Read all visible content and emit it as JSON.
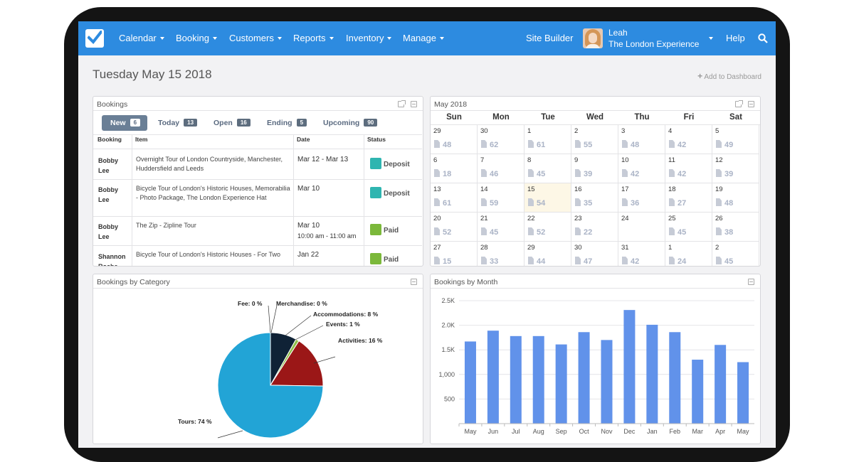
{
  "nav": {
    "menu": [
      {
        "label": "Calendar"
      },
      {
        "label": "Booking"
      },
      {
        "label": "Customers"
      },
      {
        "label": "Reports"
      },
      {
        "label": "Inventory"
      },
      {
        "label": "Manage"
      }
    ],
    "site_builder": "Site Builder",
    "user_name": "Leah",
    "user_company": "The London Experience",
    "help": "Help",
    "accent": "#2d8be0"
  },
  "page": {
    "title": "Tuesday May 15 2018",
    "add_to_dashboard": "Add to Dashboard"
  },
  "bookings": {
    "title": "Bookings",
    "tabs": [
      {
        "label": "New",
        "count": "6"
      },
      {
        "label": "Today",
        "count": "13"
      },
      {
        "label": "Open",
        "count": "16"
      },
      {
        "label": "Ending",
        "count": "5"
      },
      {
        "label": "Upcoming",
        "count": "90"
      }
    ],
    "columns": [
      "Booking",
      "Item",
      "Date",
      "Status"
    ],
    "rows": [
      {
        "name": "Bobby Lee",
        "item": "Overnight Tour of London Countryside, Manchester, Huddersfield and Leeds",
        "date": "Mar 12 - Mar 13",
        "time": "",
        "status": "Deposit",
        "color": "#2fb5b0"
      },
      {
        "name": "Bobby Lee",
        "item": "Bicycle Tour of London's Historic Houses, Memorabilia - Photo Package, The London Experience Hat",
        "date": "Mar 10",
        "time": "",
        "status": "Deposit",
        "color": "#2fb5b0"
      },
      {
        "name": "Bobby Lee",
        "item": "The Zip - Zipline Tour",
        "date": "Mar 10",
        "time": "10:00 am - 11:00 am",
        "status": "Paid",
        "color": "#7bb83a"
      },
      {
        "name": "Shannon Roche",
        "item": "Bicycle Tour of London's Historic Houses - For Two",
        "date": "Jan 22",
        "time": "",
        "status": "Paid",
        "color": "#7bb83a"
      }
    ]
  },
  "calendar": {
    "title": "May 2018",
    "days_of_week": [
      "Sun",
      "Mon",
      "Tue",
      "Wed",
      "Thu",
      "Fri",
      "Sat"
    ],
    "weeks": [
      [
        {
          "d": "29",
          "c": "48"
        },
        {
          "d": "30",
          "c": "62"
        },
        {
          "d": "1",
          "c": "61"
        },
        {
          "d": "2",
          "c": "55"
        },
        {
          "d": "3",
          "c": "48"
        },
        {
          "d": "4",
          "c": "42"
        },
        {
          "d": "5",
          "c": "49"
        }
      ],
      [
        {
          "d": "6",
          "c": "18"
        },
        {
          "d": "7",
          "c": "46"
        },
        {
          "d": "8",
          "c": "45"
        },
        {
          "d": "9",
          "c": "39"
        },
        {
          "d": "10",
          "c": "42"
        },
        {
          "d": "11",
          "c": "42"
        },
        {
          "d": "12",
          "c": "39"
        }
      ],
      [
        {
          "d": "13",
          "c": "61"
        },
        {
          "d": "14",
          "c": "59"
        },
        {
          "d": "15",
          "c": "54",
          "today": true
        },
        {
          "d": "16",
          "c": "35"
        },
        {
          "d": "17",
          "c": "36"
        },
        {
          "d": "18",
          "c": "27"
        },
        {
          "d": "19",
          "c": "48"
        }
      ],
      [
        {
          "d": "20",
          "c": "52"
        },
        {
          "d": "21",
          "c": "45"
        },
        {
          "d": "22",
          "c": "52"
        },
        {
          "d": "23",
          "c": "22"
        },
        {
          "d": "24",
          "c": ""
        },
        {
          "d": "25",
          "c": "45"
        },
        {
          "d": "26",
          "c": "38"
        }
      ],
      [
        {
          "d": "27",
          "c": "15"
        },
        {
          "d": "28",
          "c": "33"
        },
        {
          "d": "29",
          "c": "44"
        },
        {
          "d": "30",
          "c": "47"
        },
        {
          "d": "31",
          "c": "42"
        },
        {
          "d": "1",
          "c": "24"
        },
        {
          "d": "2",
          "c": "45"
        }
      ]
    ]
  },
  "category_chart": {
    "panel_title": "Bookings by Category",
    "chart_data": {
      "type": "pie",
      "slices": [
        {
          "name": "Tours",
          "value": 74,
          "label": "Tours: 74 %",
          "color": "#22a4d6"
        },
        {
          "name": "Fee",
          "value": 0,
          "label": "Fee: 0 %",
          "color": "#1a2a3e"
        },
        {
          "name": "Merchandise",
          "value": 0,
          "label": "Merchandise: 0 %",
          "color": "#2a3f55"
        },
        {
          "name": "Accommodations",
          "value": 8,
          "label": "Accommodations: 8 %",
          "color": "#0f2236"
        },
        {
          "name": "Events",
          "value": 1,
          "label": "Events: 1 %",
          "color": "#8fbf4a"
        },
        {
          "name": "Activities",
          "value": 16,
          "label": "Activities: 16 %",
          "color": "#9b1717"
        }
      ]
    }
  },
  "month_chart": {
    "panel_title": "Bookings by Month",
    "chart_data": {
      "type": "bar",
      "categories": [
        "May",
        "Jun",
        "Jul",
        "Aug",
        "Sep",
        "Oct",
        "Nov",
        "Dec",
        "Jan",
        "Feb",
        "Mar",
        "Apr",
        "May"
      ],
      "values": [
        1670,
        1890,
        1780,
        1780,
        1610,
        1860,
        1700,
        2310,
        2010,
        1860,
        1300,
        1600,
        1250
      ],
      "ylim": [
        0,
        2500
      ],
      "yticks": [
        "500",
        "1,000",
        "1.5K",
        "2.0K",
        "2.5K"
      ],
      "ytick_values": [
        500,
        1000,
        1500,
        2000,
        2500
      ],
      "grid": true,
      "bar_color": "#6192ea"
    }
  }
}
